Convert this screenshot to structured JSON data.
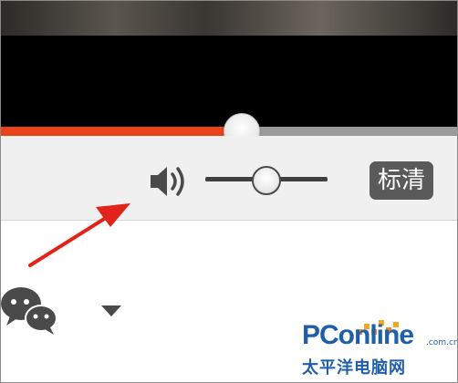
{
  "player": {
    "progress_fraction": 0.525,
    "volume_fraction": 0.5,
    "quality_label": "标清"
  },
  "colors": {
    "progress": "#e8431b",
    "track": "#9a9a9a",
    "arrow": "#e2231a",
    "brand": "#1f5fa8"
  },
  "icons": {
    "volume": "speaker-icon",
    "share": "wechat-icon",
    "dropdown": "dropdown-triangle-icon"
  },
  "watermark": {
    "brand_main": "PConline",
    "brand_suffix": ".com.cn",
    "brand_cn": "太平洋电脑网"
  }
}
